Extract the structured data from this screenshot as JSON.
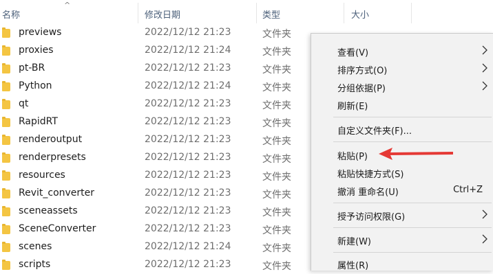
{
  "columns": {
    "name": "名称",
    "date": "修改日期",
    "type": "类型",
    "size": "大小"
  },
  "sort_indicator": "^",
  "files": [
    {
      "name": "previews",
      "date": "2022/12/12 21:23",
      "type": "文件夹"
    },
    {
      "name": "proxies",
      "date": "2022/12/12 21:24",
      "type": "文件夹"
    },
    {
      "name": "pt-BR",
      "date": "2022/12/12 21:23",
      "type": "文件夹"
    },
    {
      "name": "Python",
      "date": "2022/12/12 21:24",
      "type": "文件夹"
    },
    {
      "name": "qt",
      "date": "2022/12/12 21:23",
      "type": "文件夹"
    },
    {
      "name": "RapidRT",
      "date": "2022/12/12 21:23",
      "type": "文件夹"
    },
    {
      "name": "renderoutput",
      "date": "2022/12/12 21:23",
      "type": "文件夹"
    },
    {
      "name": "renderpresets",
      "date": "2022/12/12 21:23",
      "type": "文件夹"
    },
    {
      "name": "resources",
      "date": "2022/12/12 21:23",
      "type": "文件夹"
    },
    {
      "name": "Revit_converter",
      "date": "2022/12/12 21:23",
      "type": "文件夹"
    },
    {
      "name": "sceneassets",
      "date": "2022/12/12 21:23",
      "type": "文件夹"
    },
    {
      "name": "SceneConverter",
      "date": "2022/12/12 21:23",
      "type": "文件夹"
    },
    {
      "name": "scenes",
      "date": "2022/12/12 21:24",
      "type": "文件夹"
    },
    {
      "name": "scripts",
      "date": "2022/12/12 21:23",
      "type": "文件夹"
    }
  ],
  "context_menu": {
    "view": "查看(V)",
    "sort": "排序方式(O)",
    "group": "分组依据(P)",
    "refresh": "刷新(E)",
    "customize": "自定义文件夹(F)...",
    "paste": "粘贴(P)",
    "paste_shortcut": "粘贴快捷方式(S)",
    "undo": "撤消 重命名(U)",
    "undo_shortcut": "Ctrl+Z",
    "grant_access": "授予访问权限(G)",
    "new": "新建(W)",
    "properties": "属性(R)"
  },
  "colors": {
    "folder": "#f4c542",
    "menu_bg": "#f2f2f2",
    "annotation_arrow": "#e53935",
    "header_text": "#4c607a"
  },
  "icons": {
    "folder": "folder-icon",
    "submenu": "chevron-right-icon",
    "annotation": "red-arrow-annotation"
  }
}
